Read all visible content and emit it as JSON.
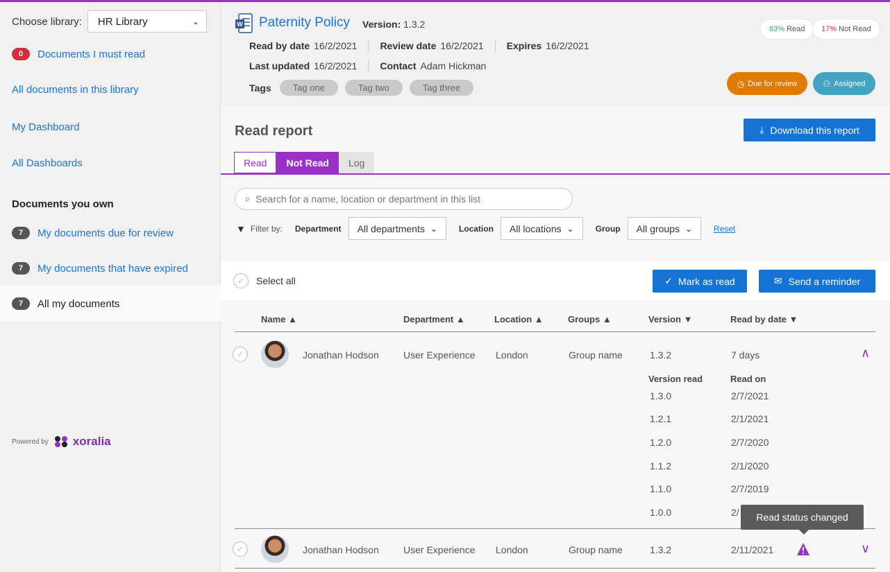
{
  "sidebar": {
    "choose_label": "Choose library:",
    "library_value": "HR Library",
    "must_read_count": "0",
    "must_read_label": "Documents I must read",
    "all_docs_label": "All documents in this library",
    "my_dashboard": "My Dashboard",
    "all_dashboards": "All Dashboards",
    "owned_heading": "Documents you own",
    "due_count": "7",
    "due_label": "My documents due for review",
    "expired_count": "7",
    "expired_label": "My documents that have expired",
    "all_my_count": "7",
    "all_my_label": "All my documents",
    "powered_by": "Powered by",
    "brand": "xoralia"
  },
  "doc": {
    "title": "Paternity Policy",
    "version_label": "Version:",
    "version": "1.3.2",
    "read_by_label": "Read by date",
    "read_by": "16/2/2021",
    "review_label": "Review date",
    "review": "16/2/2021",
    "expires_label": "Expires",
    "expires": "16/2/2021",
    "updated_label": "Last updated",
    "updated": "16/2/2021",
    "contact_label": "Contact",
    "contact": "Adam Hickman",
    "tags_label": "Tags",
    "tags": [
      "Tag one",
      "Tag two",
      "Tag three"
    ],
    "read_pct": "83%",
    "read_word": "Read",
    "notread_pct": "17%",
    "notread_word": "Not Read",
    "due_review": "Due for review",
    "assigned": "Assigned"
  },
  "report": {
    "title": "Read report",
    "download": "Download this report",
    "tabs": [
      "Read",
      "Not Read",
      "Log"
    ],
    "search_placeholder": "Search for a name, location or department in this list",
    "filter_by": "Filter by:",
    "department_label": "Department",
    "department_value": "All departments",
    "location_label": "Location",
    "location_value": "All locations",
    "group_label": "Group",
    "group_value": "All groups",
    "reset": "Reset",
    "select_all": "Select all",
    "mark_as_read": "Mark as read",
    "send_reminder": "Send a reminder"
  },
  "table": {
    "headers": [
      "Name",
      "Department",
      "Location",
      "Groups",
      "Version",
      "Read by date"
    ],
    "rows": [
      {
        "name": "Jonathan Hodson",
        "department": "User Experience",
        "location": "London",
        "group": "Group name",
        "version": "1.3.2",
        "read_by": "7 days"
      },
      {
        "name": "Jonathan Hodson",
        "department": "User Experience",
        "location": "London",
        "group": "Group name",
        "version": "1.3.2",
        "read_by": "2/11/2021"
      }
    ],
    "history_headers": [
      "Version read",
      "Read on"
    ],
    "history": [
      {
        "version": "1.3.0",
        "date": "2/7/2021"
      },
      {
        "version": "1.2.1",
        "date": "2/1/2021"
      },
      {
        "version": "1.2.0",
        "date": "2/7/2020"
      },
      {
        "version": "1.1.2",
        "date": "2/1/2020"
      },
      {
        "version": "1.1.0",
        "date": "2/7/2019"
      },
      {
        "version": "1.0.0",
        "date": "2/"
      }
    ],
    "tooltip": "Read status changed"
  },
  "colors": {
    "accent": "#9b30c8",
    "link": "#1a73d9",
    "button": "#1573d4",
    "due": "#e07a00",
    "assigned": "#44a3c0"
  }
}
